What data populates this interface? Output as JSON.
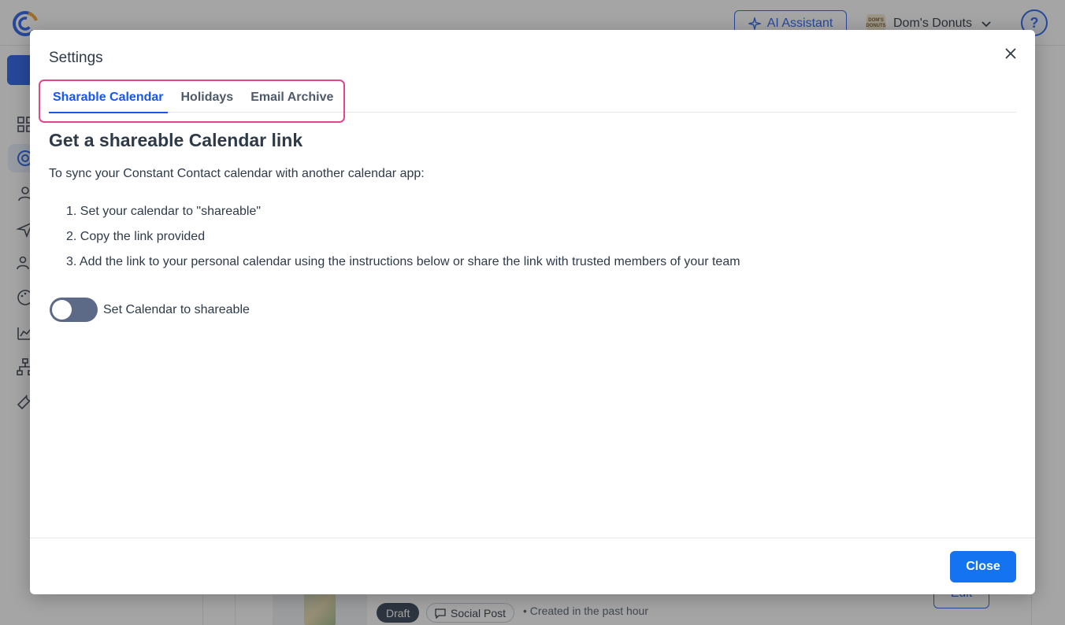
{
  "topbar": {
    "ai_label": "AI Assistant",
    "account_name": "Dom's Donuts",
    "account_logo_text": "DOM'S DONUTS",
    "help_glyph": "?"
  },
  "background": {
    "status_badge": "Draft",
    "type_badge": "Social Post",
    "created_text": "• Created in the past hour",
    "edit_label": "Edit"
  },
  "modal": {
    "title": "Settings",
    "tabs": [
      {
        "label": "Sharable Calendar",
        "active": true
      },
      {
        "label": "Holidays",
        "active": false
      },
      {
        "label": "Email Archive",
        "active": false
      }
    ],
    "heading": "Get a shareable Calendar link",
    "intro": "To sync your Constant Contact calendar with another calendar app:",
    "steps": [
      "1. Set your calendar to \"shareable\"",
      "2. Copy the link provided",
      "3. Add the link to your personal calendar using the instructions below or share the link with trusted members of your team"
    ],
    "toggle": {
      "label": "Set Calendar to shareable",
      "on": false
    },
    "close_button": "Close"
  },
  "colors": {
    "accent": "#1856ed",
    "highlight": "#e0478f",
    "toggle_off": "#5d6a87"
  }
}
